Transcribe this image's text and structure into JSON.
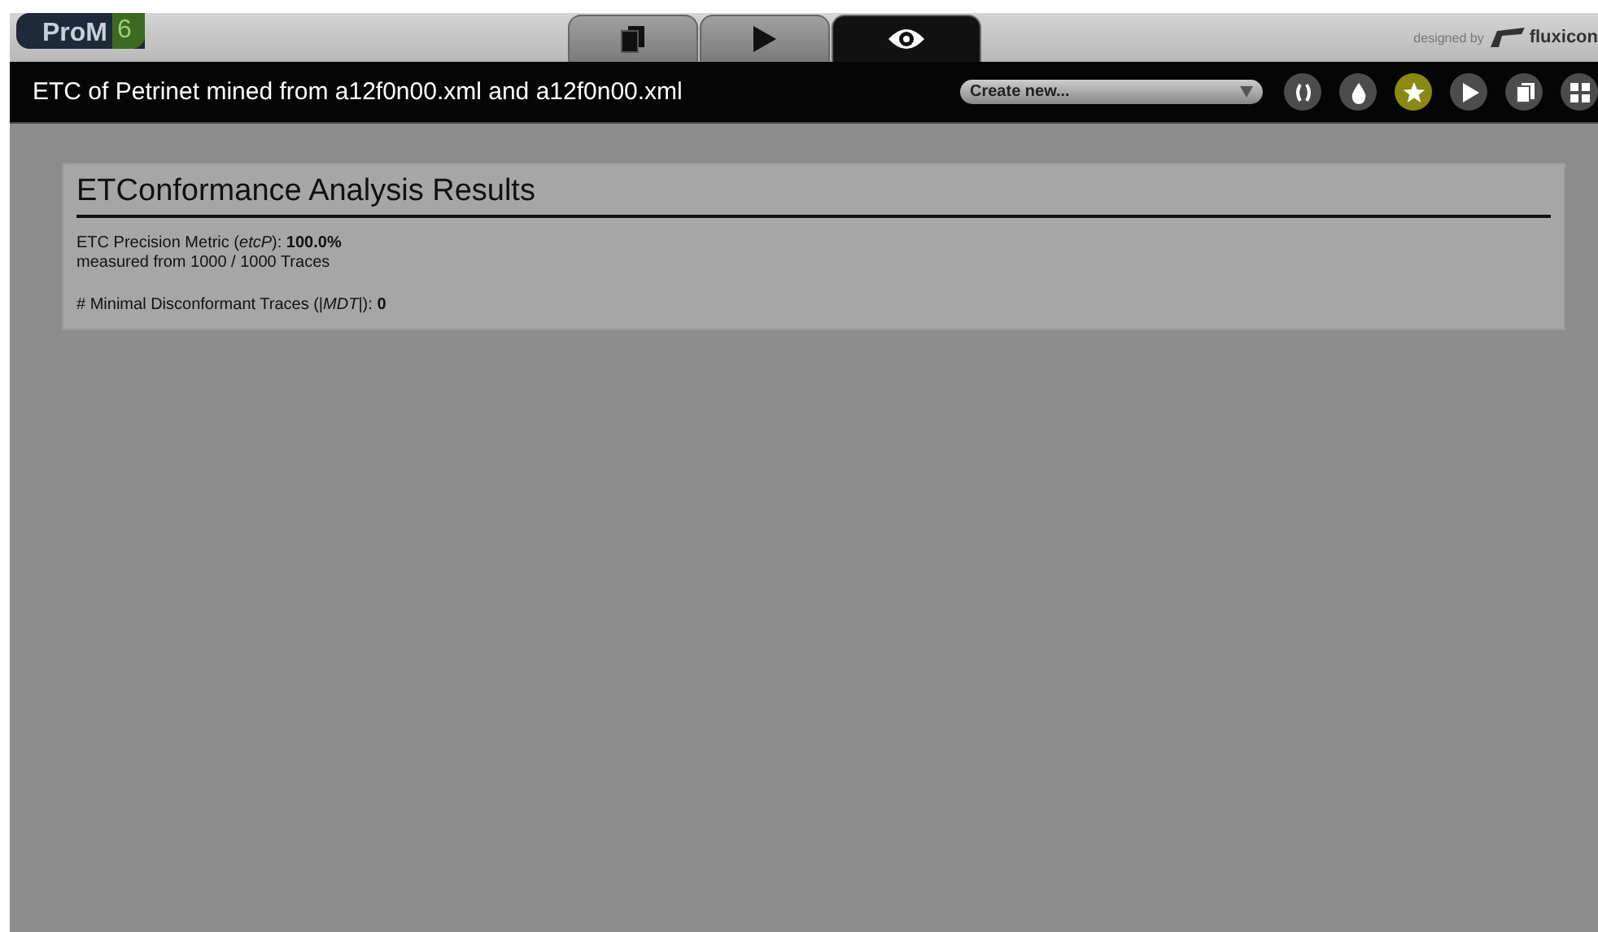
{
  "logo": {
    "name": "ProM",
    "version": "6"
  },
  "tabs": [
    {
      "kind": "workspace",
      "selected": false
    },
    {
      "kind": "actions",
      "selected": false
    },
    {
      "kind": "view",
      "selected": true
    }
  ],
  "credit": {
    "prefix": "designed by",
    "brand": "fluxicon"
  },
  "title": "ETC of Petrinet mined from a12f0n00.xml and a12f0n00.xml",
  "create_select": {
    "value": "Create new..."
  },
  "toolbar": [
    {
      "kind": "braces",
      "selected": false
    },
    {
      "kind": "drop",
      "selected": false
    },
    {
      "kind": "star",
      "selected": true
    },
    {
      "kind": "play",
      "selected": false
    },
    {
      "kind": "copy",
      "selected": false
    },
    {
      "kind": "grid",
      "selected": false
    }
  ],
  "panel": {
    "heading": "ETConformance Analysis Results",
    "groups": [
      {
        "lines": [
          "ETC Precision Metric (*etcP*): **100.0%**",
          "measured from 1000 / 1000 Traces"
        ]
      },
      {
        "lines": [
          "# Minimal Disconformant Traces (|*MDT*|): **0**"
        ]
      }
    ]
  }
}
